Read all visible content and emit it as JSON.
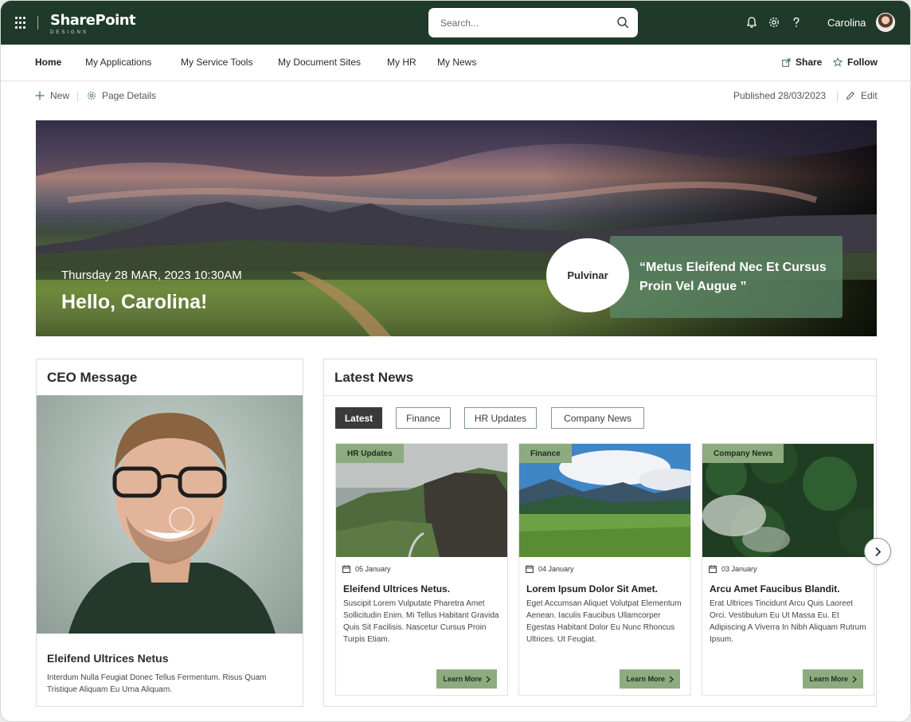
{
  "header": {
    "logo_text": "SharePoint",
    "logo_sub": "DESIGNS",
    "search_placeholder": "Search...",
    "user_name": "Carolina",
    "icons": [
      "app-launcher-icon",
      "search-icon",
      "bell-icon",
      "gear-icon",
      "help-icon"
    ]
  },
  "nav": {
    "items": [
      "Home",
      "My Applications",
      "My Service Tools",
      "My Document Sites",
      "My HR",
      "My News"
    ],
    "share_label": "Share",
    "follow_label": "Follow"
  },
  "commandbar": {
    "new_label": "New",
    "page_details_label": "Page Details",
    "published": "Published 28/03/2023",
    "edit_label": "Edit"
  },
  "hero": {
    "datetime": "Thursday 28 MAR, 2023  10:30AM",
    "greeting": "Hello, Carolina!",
    "circle_label": "Pulvinar",
    "quote": "“Metus Eleifend Nec Et Cursus Proin Vel Augue ”"
  },
  "ceo": {
    "title": "CEO Message",
    "name": "Eleifend Ultrices Netus",
    "text": "Interdum Nulla Feugiat Donec Tellus Fermentum. Risus Quam Tristique Aliquam Eu Urna Aliquam."
  },
  "news": {
    "title": "Latest News",
    "tabs": [
      "Latest",
      "Finance",
      "HR Updates",
      "Company News"
    ],
    "active_tab": "Latest",
    "cards": [
      {
        "badge": "HR Updates",
        "date": "05 January",
        "headline": "Eleifend Ultrices Netus.",
        "body": "Suscipit Lorem Vulputate Pharetra Amet Sollicitudin Enim. Mi Tellus Habitant Gravida Quis Sit Facilisis. Nascetur Cursus Proin Turpis Etiam.",
        "button": "Learn More"
      },
      {
        "badge": "Finance",
        "date": "04 January",
        "headline": "Lorem Ipsum Dolor Sit Amet.",
        "body": "Eget Accumsan Aliquet Volutpat Elementum Aenean. Iaculis Faucibus Ullamcorper Egestas Habitant Dolor Eu Nunc Rhoncus Ultrices. Ut Feugiat.",
        "button": "Learn More"
      },
      {
        "badge": "Company News",
        "date": "03 January",
        "headline": "Arcu Amet Faucibus Blandit.",
        "body": "Erat Ultrices Tincidunt Arcu Quis Laoreet Orci. Vestibulum Eu Ut Massa Eu. Et Adipiscing A Viverra In Nibh Aliquam Rutrum Ipsum.",
        "button": "Learn More"
      }
    ]
  },
  "colors": {
    "header_bg": "#1f3a2a",
    "accent_green": "#8cab7f",
    "quote_box": "#5c8668",
    "tab_border": "#7f9b84",
    "active_tab_bg": "#3a3a3a"
  }
}
